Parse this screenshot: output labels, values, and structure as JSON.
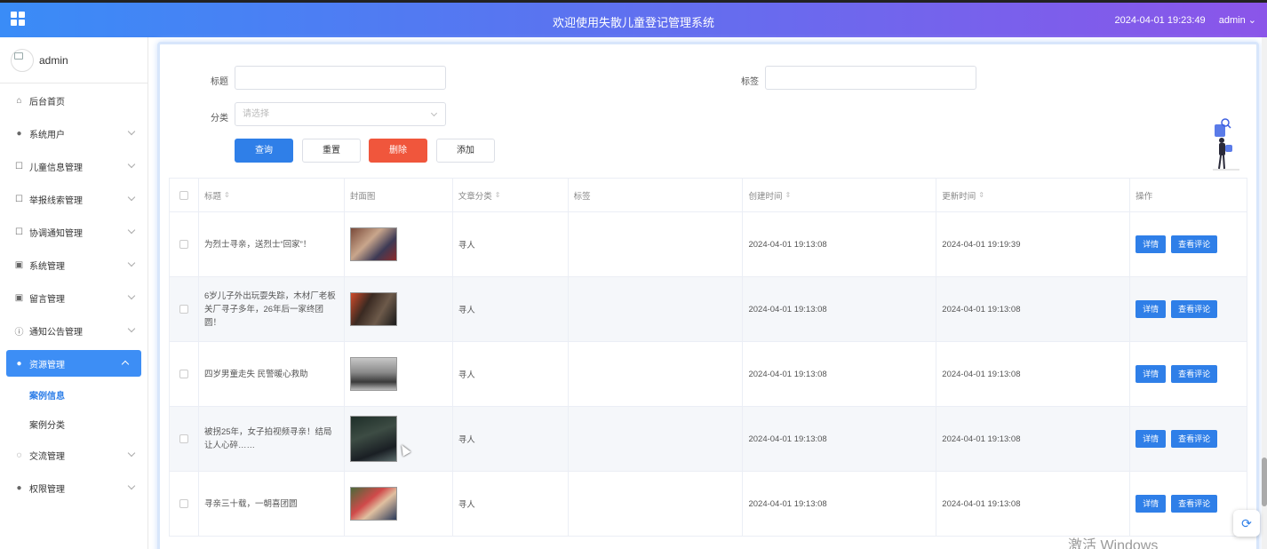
{
  "header": {
    "title": "欢迎使用失散儿童登记管理系统",
    "datetime": "2024-04-01 19:23:49",
    "user": "admin"
  },
  "sidebar": {
    "user_name": "admin",
    "items": [
      {
        "label": "后台首页",
        "icon": "home-icon"
      },
      {
        "label": "系统用户",
        "icon": "user-icon"
      },
      {
        "label": "儿童信息管理",
        "icon": "edit-icon"
      },
      {
        "label": "举报线索管理",
        "icon": "edit-icon"
      },
      {
        "label": "协调通知管理",
        "icon": "edit-icon"
      },
      {
        "label": "系统管理",
        "icon": "image-icon"
      },
      {
        "label": "留言管理",
        "icon": "image-icon"
      },
      {
        "label": "通知公告管理",
        "icon": "info-icon"
      },
      {
        "label": "资源管理",
        "icon": "location-icon"
      },
      {
        "label": "交流管理",
        "icon": "chat-icon"
      },
      {
        "label": "权限管理",
        "icon": "user-icon"
      }
    ],
    "sub_items": [
      {
        "label": "案例信息"
      },
      {
        "label": "案例分类"
      }
    ]
  },
  "filters": {
    "title_label": "标题",
    "tag_label": "标签",
    "category_label": "分类",
    "category_placeholder": "请选择"
  },
  "buttons": {
    "query": "查询",
    "reset": "重置",
    "delete": "删除",
    "add": "添加"
  },
  "table": {
    "headers": [
      "标题",
      "封面图",
      "文章分类",
      "标签",
      "创建时间",
      "更新时间",
      "操作"
    ],
    "rows": [
      {
        "title": "为烈士寻亲，送烈士“回家”！",
        "category": "寻人",
        "tag": "",
        "created": "2024-04-01 19:13:08",
        "updated": "2024-04-01 19:19:39"
      },
      {
        "title": "6岁儿子外出玩耍失踪，木材厂老板关厂寻子多年，26年后一家终团圆！",
        "category": "寻人",
        "tag": "",
        "created": "2024-04-01 19:13:08",
        "updated": "2024-04-01 19:13:08"
      },
      {
        "title": "四岁男童走失 民警暖心救助",
        "category": "寻人",
        "tag": "",
        "created": "2024-04-01 19:13:08",
        "updated": "2024-04-01 19:13:08"
      },
      {
        "title": "被拐25年，女子拍视频寻亲！结局让人心碎……",
        "category": "寻人",
        "tag": "",
        "created": "2024-04-01 19:13:08",
        "updated": "2024-04-01 19:13:08"
      },
      {
        "title": "寻亲三十载，一朝喜团圆",
        "category": "寻人",
        "tag": "",
        "created": "2024-04-01 19:13:08",
        "updated": "2024-04-01 19:13:08"
      }
    ],
    "action_detail": "详情",
    "action_comments": "查看评论"
  },
  "watermark": "激活 Windows"
}
